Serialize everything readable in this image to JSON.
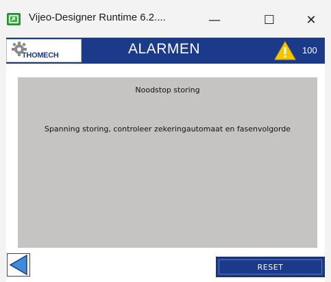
{
  "window": {
    "title": "Vijeo-Designer Runtime 6.2....",
    "minimize_symbol": "—",
    "maximize_symbol": "☐",
    "close_symbol": "✕"
  },
  "header": {
    "logo_text": "THOMECH",
    "title": "ALARMEN",
    "alarm_count": "100",
    "warning_icon": "warning-triangle"
  },
  "alarm": {
    "title": "Noodstop storing",
    "message": "Spanning storing, controleer zekeringautomaat en fasenvolgorde"
  },
  "footer": {
    "back_icon": "triangle-left",
    "reset_label": "RESET"
  },
  "colors": {
    "header_blue": "#1c3a8a",
    "panel_grey": "#c6c3c3",
    "warning_yellow": "#f5c400",
    "app_icon_green": "#3fae49"
  }
}
